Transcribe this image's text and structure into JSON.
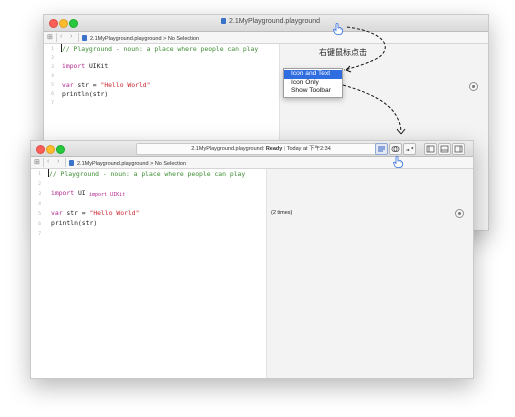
{
  "back_window": {
    "title": "2.1MyPlayground.playground",
    "jumpbar": {
      "file": "2.1MyPlayground.playground",
      "separator": ">",
      "selection": "No Selection"
    },
    "line_numbers": [
      "1",
      "2",
      "3",
      "4",
      "5",
      "6",
      "7"
    ],
    "code": {
      "line1": "// Playground - noun: a place where people can play",
      "line3_kw": "import",
      "line3_ty": "UIKit",
      "line5_kw": "var",
      "line5_mid": " str = ",
      "line5_str": "\"Hello World\"",
      "line6": "println(str)"
    }
  },
  "context_menu": {
    "items": [
      "Icon and Text",
      "Icon Only",
      "Show Toolbar"
    ],
    "selected_index": 0
  },
  "annotation": "右键鼠标点击",
  "front_window": {
    "status": {
      "file": "2.1MyPlayground.playground:",
      "state": "Ready",
      "separator": "|",
      "time": "Today at 下午2:34"
    },
    "jumpbar": {
      "file": "2.1MyPlayground.playground",
      "separator": ">",
      "selection": "No Selection"
    },
    "line_numbers": [
      "1",
      "2",
      "3",
      "4",
      "5",
      "6",
      "7"
    ],
    "code": {
      "line1": "// Playground - noun: a place where people can play",
      "line3_kw": "import",
      "line3_partial": "UI",
      "autocomplete": "import UIKit",
      "line5_kw": "var",
      "line5_mid": " str = ",
      "line5_str": "\"Hello World\"",
      "line6": "println(str)"
    },
    "result": "(2 times)"
  },
  "colors": {
    "comment": "#3a8a2f",
    "keyword": "#b0278f",
    "string": "#c8242c",
    "menu_selection": "#2f6de0"
  }
}
